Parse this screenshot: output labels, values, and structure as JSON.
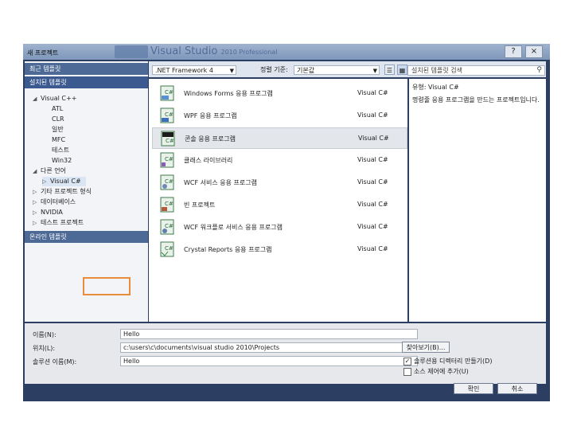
{
  "dialog": {
    "title": "새 프로젝트",
    "brand_text": "Visual Studio",
    "brand_sub": "2010 Professional",
    "help_glyph": "?",
    "close_glyph": "×"
  },
  "sidebar": {
    "recent_templates": "최근 템플릿",
    "installed_templates": "설치된 템플릿",
    "online_templates": "온라인 템플릿",
    "tree": [
      {
        "label": "Visual C++",
        "arrow": "◢"
      },
      {
        "label": "ATL",
        "arrow": ""
      },
      {
        "label": "CLR",
        "arrow": ""
      },
      {
        "label": "일반",
        "arrow": ""
      },
      {
        "label": "MFC",
        "arrow": ""
      },
      {
        "label": "테스트",
        "arrow": ""
      },
      {
        "label": "Win32",
        "arrow": ""
      },
      {
        "label": "다른 언어",
        "arrow": "◢"
      },
      {
        "label": "Visual C#",
        "arrow": "▷"
      },
      {
        "label": "기타 프로젝트 형식",
        "arrow": "▷"
      },
      {
        "label": "데이터베이스",
        "arrow": "▷"
      },
      {
        "label": "NVIDIA",
        "arrow": "▷"
      },
      {
        "label": "테스트 프로젝트",
        "arrow": "▷"
      }
    ]
  },
  "toolbar": {
    "framework": ".NET Framework 4",
    "sort_label": "정렬 기준:",
    "sort_value": "기본값",
    "search_placeholder": "설치된 템플릿 검색",
    "search_icon": "search-icon"
  },
  "templates": [
    {
      "name": "Windows Forms 응용 프로그램",
      "lang": "Visual C#"
    },
    {
      "name": "WPF 응용 프로그램",
      "lang": "Visual C#"
    },
    {
      "name": "콘솔 응용 프로그램",
      "lang": "Visual C#"
    },
    {
      "name": "클래스 라이브러리",
      "lang": "Visual C#"
    },
    {
      "name": "WCF 서비스 응용 프로그램",
      "lang": "Visual C#"
    },
    {
      "name": "빈 프로젝트",
      "lang": "Visual C#"
    },
    {
      "name": "WCF 워크플로 서비스 응용 프로그램",
      "lang": "Visual C#"
    },
    {
      "name": "Crystal Reports 응용 프로그램",
      "lang": "Visual C#"
    }
  ],
  "info": {
    "type": "유형: Visual C#",
    "description": "명령줄 응용 프로그램을 만드는 프로젝트입니다."
  },
  "form": {
    "name_label": "이름(N):",
    "name_value": "Hello",
    "location_label": "위치(L):",
    "location_value": "c:\\users\\c\\documents\\visual studio 2010\\Projects",
    "solution_label": "솔루션 이름(M):",
    "solution_value": "Hello",
    "browse_label": "찾아보기(B)...",
    "create_dir_label": "솔루션용 디렉터리 만들기(D)",
    "source_control_label": "소스 제어에 추가(U)"
  },
  "buttons": {
    "ok": "확인",
    "cancel": "취소"
  },
  "colors": {
    "highlight_box": "#e98d3c",
    "dialog_bg": "#2c3f63"
  }
}
